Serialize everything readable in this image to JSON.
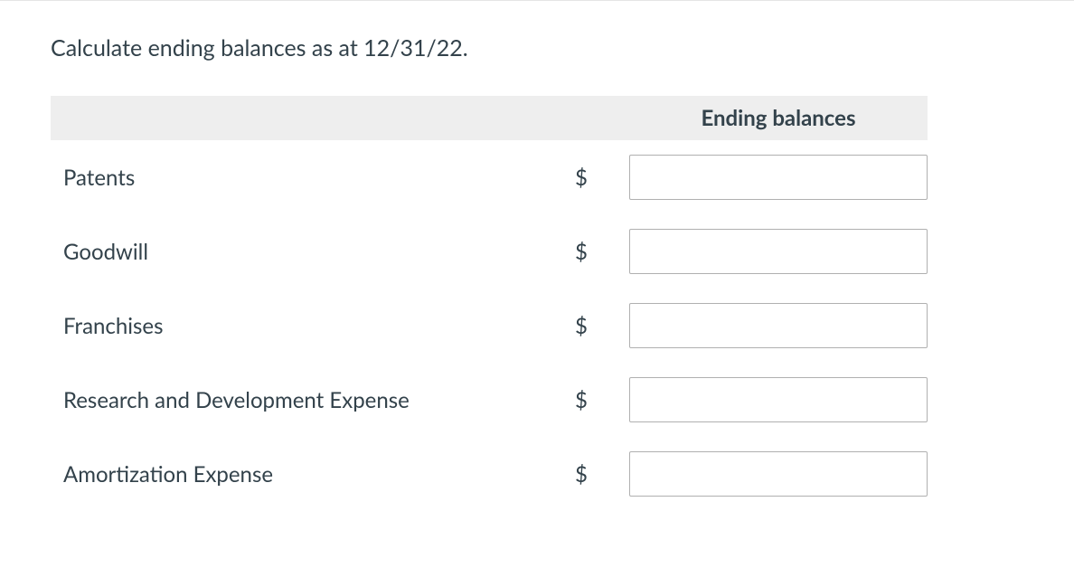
{
  "instruction": "Calculate ending balances as at 12/31/22.",
  "table": {
    "header": "Ending balances",
    "currencySymbol": "$",
    "rows": [
      {
        "label": "Patents",
        "value": ""
      },
      {
        "label": "Goodwill",
        "value": ""
      },
      {
        "label": "Franchises",
        "value": ""
      },
      {
        "label": "Research and Development Expense",
        "value": ""
      },
      {
        "label": "Amortization Expense",
        "value": ""
      }
    ]
  }
}
